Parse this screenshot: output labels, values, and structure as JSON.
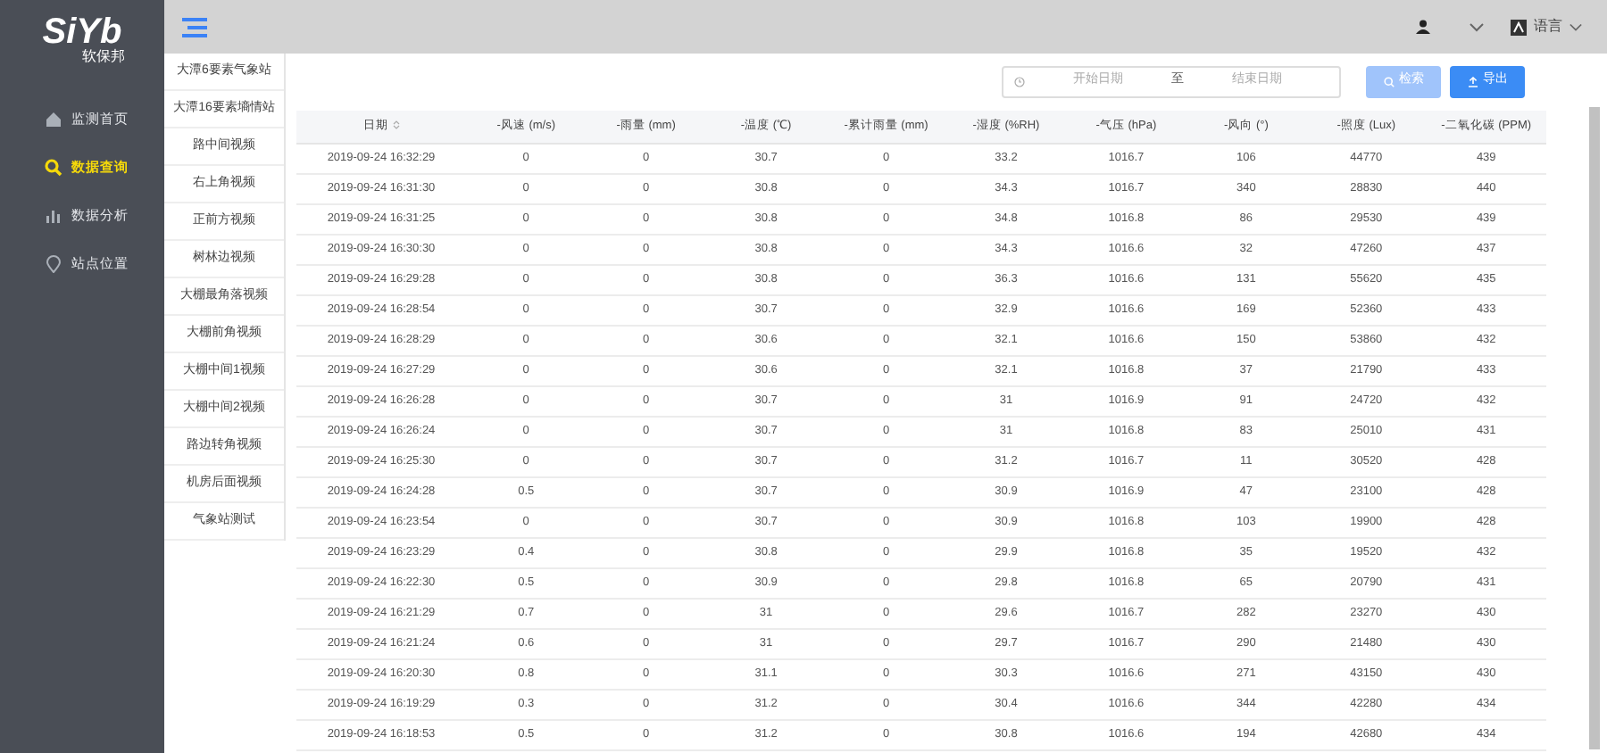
{
  "logo": {
    "text": "SiYb",
    "subtitle": "软保邦"
  },
  "nav": [
    {
      "label": "监测首页",
      "selected": false
    },
    {
      "label": "数据查询",
      "selected": true
    },
    {
      "label": "数据分析",
      "selected": false
    },
    {
      "label": "站点位置",
      "selected": false
    }
  ],
  "topbar": {
    "language": "语言"
  },
  "stations": [
    {
      "label": "大潭6要素气象站",
      "selected": false
    },
    {
      "label": "大潭16要素墒情站",
      "selected": false
    },
    {
      "label": "路中间视频",
      "selected": false
    },
    {
      "label": "右上角视频",
      "selected": false
    },
    {
      "label": "正前方视频",
      "selected": false
    },
    {
      "label": "树林边视频",
      "selected": false
    },
    {
      "label": "大棚最角落视频",
      "selected": false
    },
    {
      "label": "大棚前角视频",
      "selected": false
    },
    {
      "label": "大棚中间1视频",
      "selected": false
    },
    {
      "label": "大棚中间2视频",
      "selected": false
    },
    {
      "label": "路边转角视频",
      "selected": false
    },
    {
      "label": "机房后面视频",
      "selected": false
    },
    {
      "label": "气象站测试",
      "selected": false
    }
  ],
  "filter": {
    "start_placeholder": "开始日期",
    "separator": "至",
    "end_placeholder": "结束日期",
    "search_button": {
      "label": "检索",
      "disabled": true
    },
    "export_button": {
      "label": "导出",
      "disabled": false
    }
  },
  "table": {
    "columns": [
      "日期",
      "-风速 (m/s)",
      "-雨量 (mm)",
      "-温度 (℃)",
      "-累计雨量 (mm)",
      "-湿度 (%RH)",
      "-气压 (hPa)",
      "-风向 (°)",
      "-照度 (Lux)",
      "-二氧化碳 (PPM)"
    ],
    "rows": [
      [
        "2019-09-24 16:32:29",
        "0",
        "0",
        "30.7",
        "0",
        "33.2",
        "1016.7",
        "106",
        "44770",
        "439"
      ],
      [
        "2019-09-24 16:31:30",
        "0",
        "0",
        "30.8",
        "0",
        "34.3",
        "1016.7",
        "340",
        "28830",
        "440"
      ],
      [
        "2019-09-24 16:31:25",
        "0",
        "0",
        "30.8",
        "0",
        "34.8",
        "1016.8",
        "86",
        "29530",
        "439"
      ],
      [
        "2019-09-24 16:30:30",
        "0",
        "0",
        "30.8",
        "0",
        "34.3",
        "1016.6",
        "32",
        "47260",
        "437"
      ],
      [
        "2019-09-24 16:29:28",
        "0",
        "0",
        "30.8",
        "0",
        "36.3",
        "1016.6",
        "131",
        "55620",
        "435"
      ],
      [
        "2019-09-24 16:28:54",
        "0",
        "0",
        "30.7",
        "0",
        "32.9",
        "1016.6",
        "169",
        "52360",
        "433"
      ],
      [
        "2019-09-24 16:28:29",
        "0",
        "0",
        "30.6",
        "0",
        "32.1",
        "1016.6",
        "150",
        "53860",
        "432"
      ],
      [
        "2019-09-24 16:27:29",
        "0",
        "0",
        "30.6",
        "0",
        "32.1",
        "1016.8",
        "37",
        "21790",
        "433"
      ],
      [
        "2019-09-24 16:26:28",
        "0",
        "0",
        "30.7",
        "0",
        "31",
        "1016.9",
        "91",
        "24720",
        "432"
      ],
      [
        "2019-09-24 16:26:24",
        "0",
        "0",
        "30.7",
        "0",
        "31",
        "1016.8",
        "83",
        "25010",
        "431"
      ],
      [
        "2019-09-24 16:25:30",
        "0",
        "0",
        "30.7",
        "0",
        "31.2",
        "1016.7",
        "11",
        "30520",
        "428"
      ],
      [
        "2019-09-24 16:24:28",
        "0.5",
        "0",
        "30.7",
        "0",
        "30.9",
        "1016.9",
        "47",
        "23100",
        "428"
      ],
      [
        "2019-09-24 16:23:54",
        "0",
        "0",
        "30.7",
        "0",
        "30.9",
        "1016.8",
        "103",
        "19900",
        "428"
      ],
      [
        "2019-09-24 16:23:29",
        "0.4",
        "0",
        "30.8",
        "0",
        "29.9",
        "1016.8",
        "35",
        "19520",
        "432"
      ],
      [
        "2019-09-24 16:22:30",
        "0.5",
        "0",
        "30.9",
        "0",
        "29.8",
        "1016.8",
        "65",
        "20790",
        "431"
      ],
      [
        "2019-09-24 16:21:29",
        "0.7",
        "0",
        "31",
        "0",
        "29.6",
        "1016.7",
        "282",
        "23270",
        "430"
      ],
      [
        "2019-09-24 16:21:24",
        "0.6",
        "0",
        "31",
        "0",
        "29.7",
        "1016.7",
        "290",
        "21480",
        "430"
      ],
      [
        "2019-09-24 16:20:30",
        "0.8",
        "0",
        "31.1",
        "0",
        "30.3",
        "1016.6",
        "271",
        "43150",
        "430"
      ],
      [
        "2019-09-24 16:19:29",
        "0.3",
        "0",
        "31.2",
        "0",
        "30.4",
        "1016.6",
        "344",
        "42280",
        "434"
      ],
      [
        "2019-09-24 16:18:53",
        "0.5",
        "0",
        "31.2",
        "0",
        "30.8",
        "1016.6",
        "194",
        "42680",
        "434"
      ]
    ]
  }
}
